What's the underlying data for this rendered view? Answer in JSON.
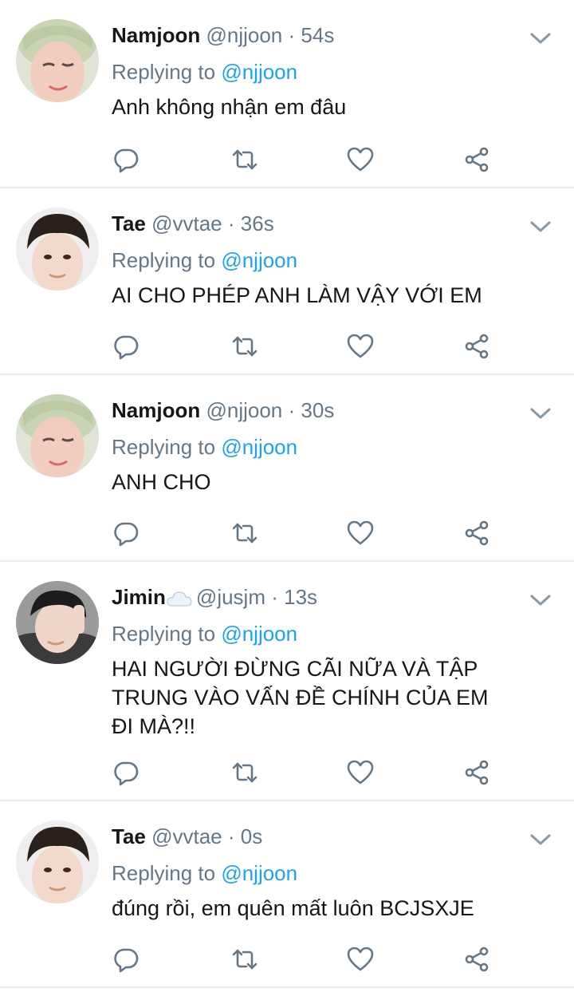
{
  "reply_prefix": "Replying to",
  "tweets": [
    {
      "name": "Namjoon",
      "has_cloud": false,
      "handle": "@njjoon",
      "separator": "·",
      "time": "54s",
      "reply_to": "@njjoon",
      "lines": [
        "Anh không nhận em đâu"
      ],
      "avatar": "namjoon-avatar"
    },
    {
      "name": "Tae",
      "has_cloud": false,
      "handle": "@vvtae",
      "separator": "·",
      "time": "36s",
      "reply_to": "@njjoon",
      "lines": [
        "AI CHO PHÉP ANH LÀM VẬY VỚI EM"
      ],
      "avatar": "tae-avatar"
    },
    {
      "name": "Namjoon",
      "has_cloud": false,
      "handle": "@njjoon",
      "separator": "·",
      "time": "30s",
      "reply_to": "@njjoon",
      "lines": [
        "ANH CHO"
      ],
      "avatar": "namjoon-avatar"
    },
    {
      "name": "Jimin",
      "has_cloud": true,
      "handle": "@jusjm",
      "separator": "·",
      "time": "13s",
      "reply_to": "@njjoon",
      "lines": [
        "HAI NGƯỜI ĐỪNG CÃI NỮA VÀ TẬP",
        "TRUNG VÀO VẤN ĐỀ CHÍNH CỦA EM",
        "ĐI MÀ?!!"
      ],
      "avatar": "jimin-avatar"
    },
    {
      "name": "Tae",
      "has_cloud": false,
      "handle": "@vvtae",
      "separator": "·",
      "time": "0s",
      "reply_to": "@njjoon",
      "lines": [
        "đúng rồi, em quên mất luôn BCJSXJE"
      ],
      "avatar": "tae-avatar"
    }
  ],
  "icons": {
    "reply": "reply-icon",
    "retweet": "retweet-icon",
    "like": "like-icon",
    "share": "share-icon",
    "menu": "chevron-down-icon"
  },
  "colors": {
    "text": "#14171a",
    "secondary": "#657786",
    "link": "#1da1f2",
    "divider": "#e6ecf0"
  }
}
